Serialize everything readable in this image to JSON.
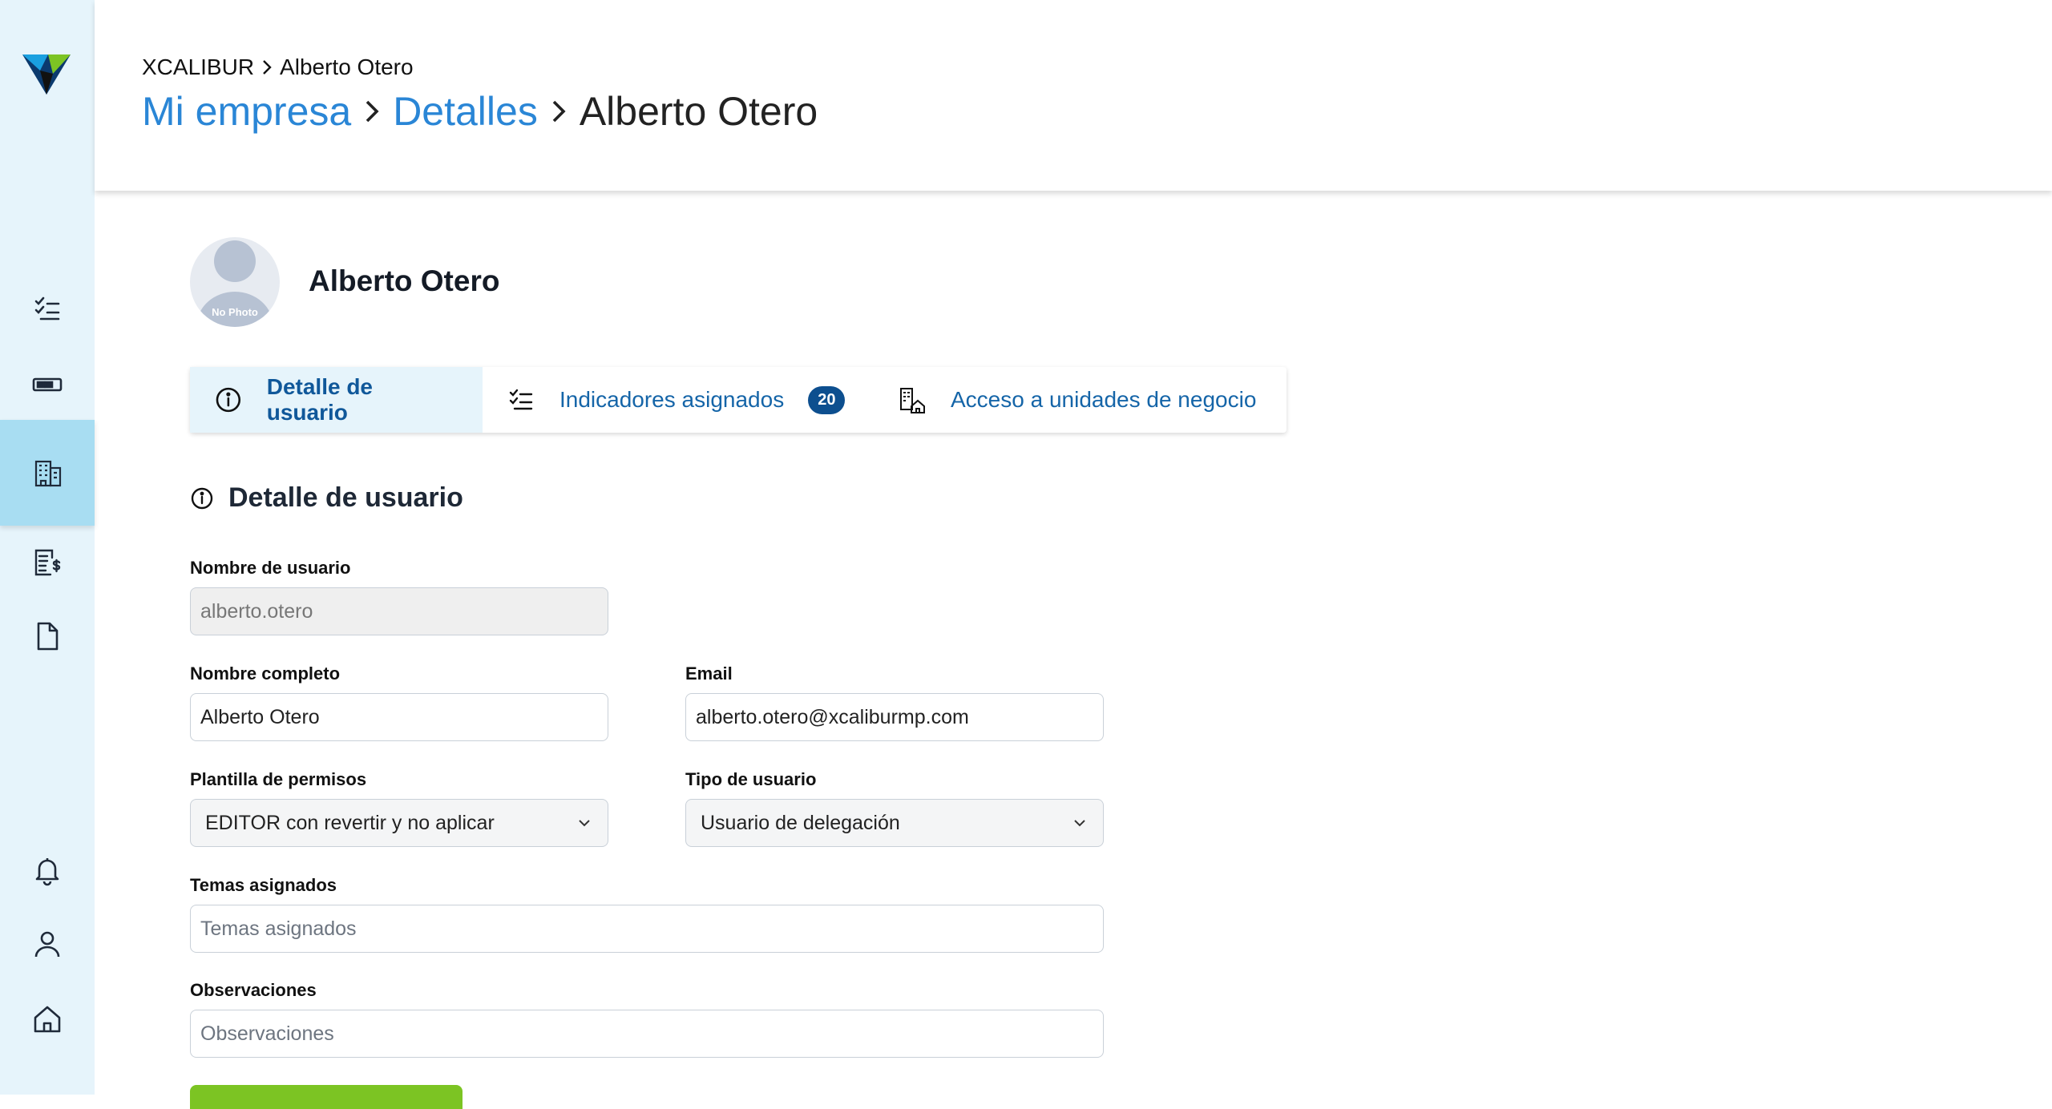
{
  "breadcrumb_top": {
    "root": "XCALIBUR",
    "current": "Alberto Otero"
  },
  "breadcrumb_main": {
    "level1": "Mi empresa",
    "level2": "Detalles",
    "current": "Alberto Otero"
  },
  "profile": {
    "name": "Alberto Otero",
    "avatar_text": "No Photo"
  },
  "tabs": [
    {
      "label": "Detalle de usuario",
      "icon": "info-icon",
      "active": true
    },
    {
      "label": "Indicadores asignados",
      "icon": "checklist-icon",
      "badge": "20"
    },
    {
      "label": "Acceso a unidades de negocio",
      "icon": "building-house-icon"
    }
  ],
  "section": {
    "title": "Detalle de usuario"
  },
  "form": {
    "username": {
      "label": "Nombre de usuario",
      "value": "alberto.otero"
    },
    "fullname": {
      "label": "Nombre completo",
      "value": "Alberto Otero"
    },
    "email": {
      "label": "Email",
      "value": "alberto.otero@xcaliburmp.com"
    },
    "permissions": {
      "label": "Plantilla de permisos",
      "value": "EDITOR con revertir y no aplicar"
    },
    "user_type": {
      "label": "Tipo de usuario",
      "value": "Usuario de delegación"
    },
    "topics": {
      "label": "Temas asignados",
      "placeholder": "Temas asignados"
    },
    "notes": {
      "label": "Observaciones",
      "placeholder": "Observaciones"
    }
  },
  "sidebar": {
    "items": [
      "checklist-icon",
      "ticket-icon",
      "building-icon",
      "invoice-dollar-icon",
      "document-icon",
      "bell-icon",
      "user-icon",
      "home-icon"
    ],
    "active": "building-icon"
  },
  "colors": {
    "accent": "#2a86d6",
    "sidebar_bg": "#e6f4fb",
    "active_bg": "#a8ddf2",
    "primary_dark": "#0d4f8f",
    "success": "#7cc423"
  }
}
